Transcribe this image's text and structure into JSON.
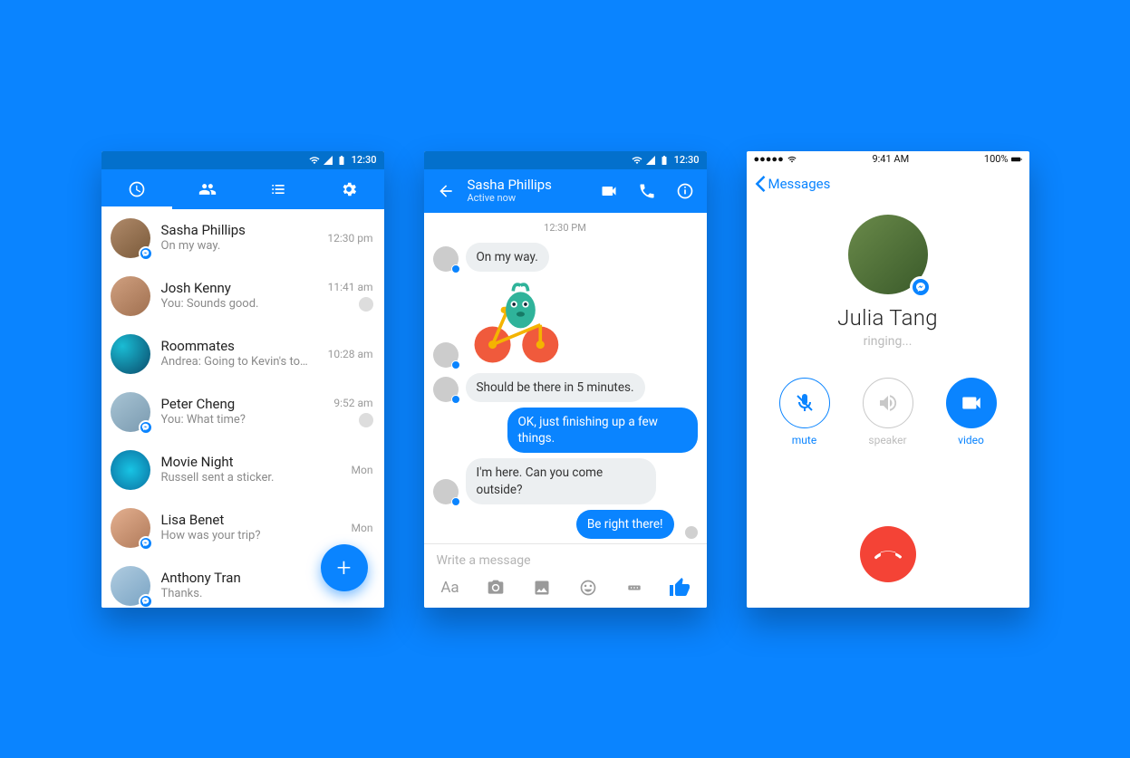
{
  "android_status": {
    "time": "12:30"
  },
  "screen1": {
    "tabs": [
      "recents",
      "people",
      "groups",
      "settings"
    ],
    "conversations": [
      {
        "name": "Sasha Phillips",
        "preview": "On my way.",
        "time": "12:30 pm",
        "badge": true,
        "sender_dot": false
      },
      {
        "name": "Josh Kenny",
        "preview": "You: Sounds good.",
        "time": "11:41 am",
        "badge": false,
        "sender_dot": true
      },
      {
        "name": "Roommates",
        "preview": "Andrea: Going to Kevin's tonight?",
        "time": "10:28 am",
        "badge": false,
        "sender_dot": false
      },
      {
        "name": "Peter Cheng",
        "preview": "You: What time?",
        "time": "9:52 am",
        "badge": true,
        "sender_dot": true
      },
      {
        "name": "Movie Night",
        "preview": "Russell sent a sticker.",
        "time": "Mon",
        "badge": false,
        "sender_dot": false
      },
      {
        "name": "Lisa Benet",
        "preview": "How was your trip?",
        "time": "Mon",
        "badge": true,
        "sender_dot": false
      },
      {
        "name": "Anthony Tran",
        "preview": "Thanks.",
        "time": "",
        "badge": true,
        "sender_dot": false
      }
    ],
    "fab_label": "+"
  },
  "screen2": {
    "header": {
      "title": "Sasha Phillips",
      "subtitle": "Active now"
    },
    "timestamp": "12:30 PM",
    "messages": [
      {
        "dir": "in",
        "text": "On my way.",
        "avatar": true
      },
      {
        "dir": "in",
        "sticker": true,
        "avatar": true
      },
      {
        "dir": "in",
        "text": "Should be there in 5 minutes.",
        "avatar": true
      },
      {
        "dir": "out",
        "text": "OK, just finishing up a few things."
      },
      {
        "dir": "in",
        "text": "I'm here. Can you come outside?",
        "avatar": true
      },
      {
        "dir": "out",
        "text": "Be right there!",
        "seen": true
      }
    ],
    "composer": {
      "placeholder": "Write a message",
      "aa": "Aa"
    }
  },
  "screen3": {
    "ios_status": {
      "time": "9:41 AM",
      "battery": "100%"
    },
    "nav": {
      "back": "Messages"
    },
    "name": "Julia Tang",
    "status": "ringing...",
    "actions": {
      "mute": "mute",
      "speaker": "speaker",
      "video": "video"
    }
  }
}
